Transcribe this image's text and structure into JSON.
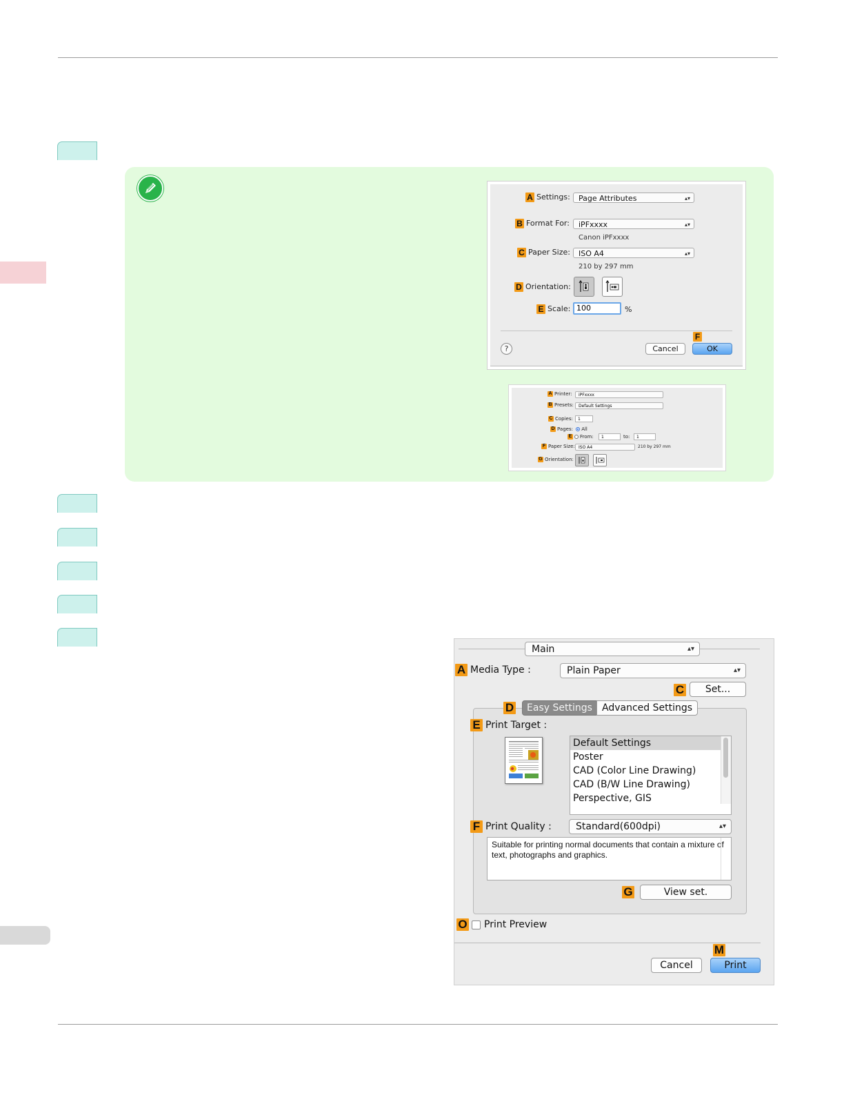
{
  "page_setup_dialog": {
    "settings": {
      "callout": "A",
      "label": "Settings:",
      "value": "Page Attributes"
    },
    "format_for": {
      "callout": "B",
      "label": "Format For:",
      "value": "iPFxxxx",
      "sub": "Canon iPFxxxx"
    },
    "paper_size": {
      "callout": "C",
      "label": "Paper Size:",
      "value": "ISO A4",
      "sub": "210 by 297 mm"
    },
    "orientation": {
      "callout": "D",
      "label": "Orientation:"
    },
    "scale": {
      "callout": "E",
      "label": "Scale:",
      "value": "100",
      "unit": "%"
    },
    "help": "?",
    "cancel": "Cancel",
    "ok_callout": "F",
    "ok": "OK"
  },
  "print_dialog_small": {
    "printer": {
      "callout": "A",
      "label": "Printer:",
      "value": "iPFxxxx"
    },
    "presets": {
      "callout": "B",
      "label": "Presets:",
      "value": "Default Settings"
    },
    "copies": {
      "callout": "C",
      "label": "Copies:",
      "value": "1"
    },
    "pages": {
      "callout": "D",
      "label": "Pages:",
      "all": "All"
    },
    "from": {
      "callout": "E",
      "label": "From:",
      "from_value": "1",
      "to_label": "to:",
      "to_value": "1"
    },
    "paper_size": {
      "callout": "F",
      "label": "Paper Size:",
      "value": "ISO A4",
      "sub": "210 by 297 mm"
    },
    "orientation": {
      "callout": "G",
      "label": "Orientation:"
    }
  },
  "main_dialog": {
    "panel": "Main",
    "media_type": {
      "callout": "A",
      "label": "Media Type :",
      "value": "Plain Paper"
    },
    "set_callout": "C",
    "set_button": "Set...",
    "tabs_callout": "D",
    "tabs": [
      "Easy Settings",
      "Advanced Settings"
    ],
    "print_target": {
      "callout": "E",
      "label": "Print Target :",
      "items": [
        "Default Settings",
        "Poster",
        "CAD (Color Line Drawing)",
        "CAD (B/W Line Drawing)",
        "Perspective, GIS"
      ]
    },
    "print_quality": {
      "callout": "F",
      "label": "Print Quality :",
      "value": "Standard(600dpi)",
      "description": "Suitable for printing normal documents that contain a mixture of text, photographs and graphics."
    },
    "view_set_callout": "G",
    "view_set": "View set.",
    "preview_callout": "O",
    "preview_label": "Print Preview",
    "cancel": "Cancel",
    "print_callout": "M",
    "print": "Print"
  },
  "colors": {
    "step_tab": "#cdf1ec",
    "note_bg": "#e3fbde",
    "callout": "#f39a16",
    "side_tab": "#f6d2d6"
  }
}
